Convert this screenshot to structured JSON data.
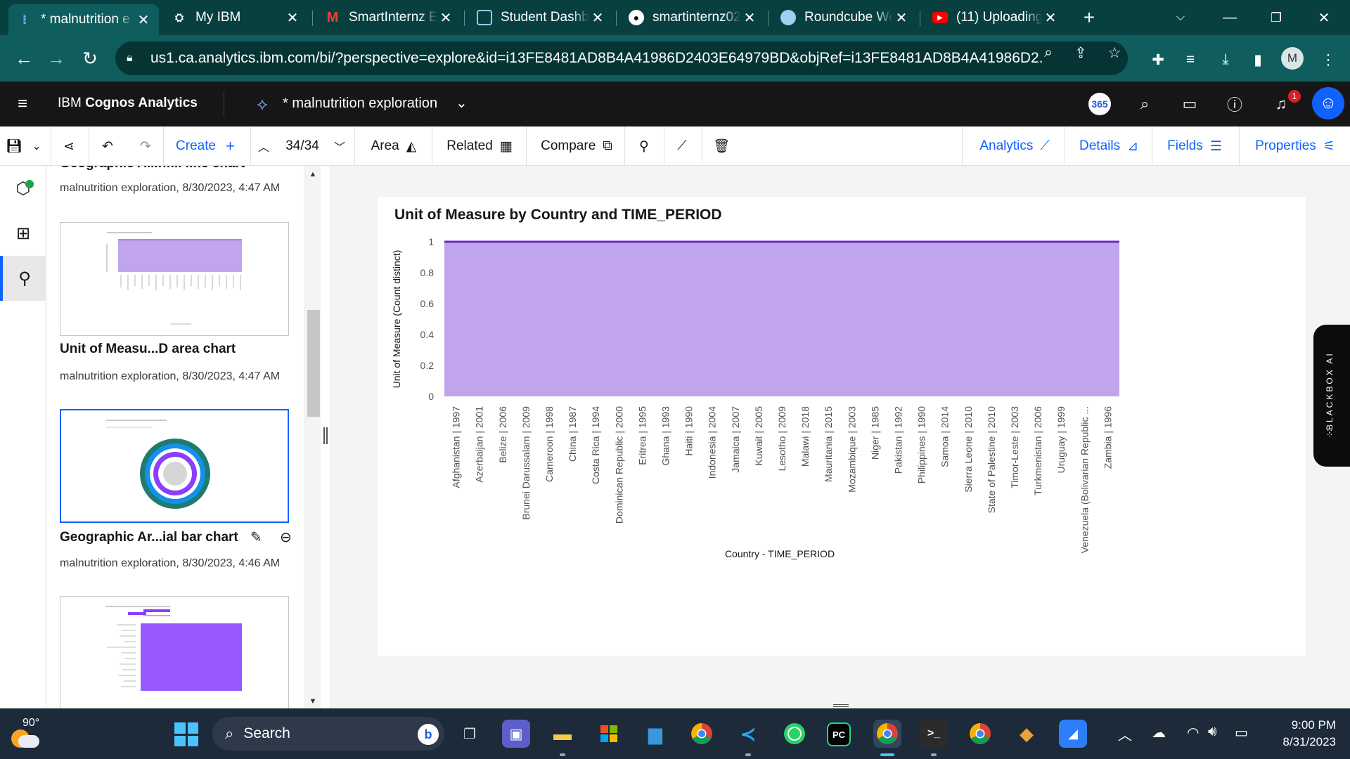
{
  "browser": {
    "tabs": [
      {
        "title": "* malnutrition e",
        "icon": "cognos-icon",
        "active": true
      },
      {
        "title": "My IBM",
        "icon": "ibm-icon"
      },
      {
        "title": "SmartInternz E",
        "icon": "gmail-icon"
      },
      {
        "title": "Student Dashb",
        "icon": "dashboard-icon"
      },
      {
        "title": "smartinternz02",
        "icon": "github-icon"
      },
      {
        "title": "Roundcube We",
        "icon": "roundcube-icon"
      },
      {
        "title": "(11) Uploading",
        "icon": "youtube-icon"
      }
    ],
    "new_tab": "+",
    "url": "us1.ca.analytics.ibm.com/bi/?perspective=explore&id=i13FE8481AD8B4A41986D2403E64979BD&objRef=i13FE8481AD8B4A41986D2...",
    "profile_initial": "M"
  },
  "app": {
    "brand_prefix": "IBM ",
    "brand_name": "Cognos Analytics",
    "doc_title": "* malnutrition exploration",
    "badge_365": "365",
    "notification_count": "1"
  },
  "toolbar": {
    "create": "Create",
    "counter": "34/34",
    "area": "Area",
    "related": "Related",
    "compare": "Compare",
    "analytics": "Analytics",
    "details": "Details",
    "fields": "Fields",
    "properties": "Properties"
  },
  "panel": {
    "cut_title": "Geographic A...nfill line chart",
    "snapshots": [
      {
        "meta": "malnutrition exploration, 8/30/2023, 4:47 AM"
      },
      {
        "title": "Unit of Measu...D area chart",
        "meta": "malnutrition exploration, 8/30/2023, 4:47 AM"
      },
      {
        "title": "Geographic Ar...ial bar chart",
        "meta": "malnutrition exploration, 8/30/2023, 4:46 AM",
        "selected": true
      }
    ]
  },
  "chart_data": {
    "type": "area",
    "title": "Unit of Measure by Country and TIME_PERIOD",
    "xlabel": "Country - TIME_PERIOD",
    "ylabel": "Unit of Measure (Count distinct)",
    "ylim": [
      0,
      1
    ],
    "yticks": [
      "0",
      "0.2",
      "0.4",
      "0.6",
      "0.8",
      "1"
    ],
    "categories": [
      "Afghanistan | 1997",
      "Azerbaijan | 2001",
      "Belize | 2006",
      "Brunei Darussalam | 2009",
      "Cameroon | 1998",
      "China | 1987",
      "Costa Rica | 1994",
      "Dominican Republic | 2000",
      "Eritrea | 1995",
      "Ghana | 1993",
      "Haiti | 1990",
      "Indonesia | 2004",
      "Jamaica | 2007",
      "Kuwait | 2005",
      "Lesotho | 2009",
      "Malawi | 2018",
      "Mauritania | 2015",
      "Mozambique | 2003",
      "Niger | 1985",
      "Pakistan | 1992",
      "Philippines | 1990",
      "Samoa | 2014",
      "Sierra Leone | 2010",
      "State of Palestine | 2010",
      "Timor-Leste | 2003",
      "Turkmenistan | 2006",
      "Uruguay | 1999",
      "Venezuela (Bolivarian Republic ...",
      "Zambia | 1996"
    ],
    "values": [
      1,
      1,
      1,
      1,
      1,
      1,
      1,
      1,
      1,
      1,
      1,
      1,
      1,
      1,
      1,
      1,
      1,
      1,
      1,
      1,
      1,
      1,
      1,
      1,
      1,
      1,
      1,
      1,
      1
    ],
    "grid": true,
    "fill_color": "#c0a5ec",
    "line_color": "#6929c4"
  },
  "widget": {
    "label": "BLACKBOX AI"
  },
  "taskbar": {
    "temperature": "90°",
    "search_placeholder": "Search",
    "time": "9:00 PM",
    "date": "8/31/2023"
  }
}
